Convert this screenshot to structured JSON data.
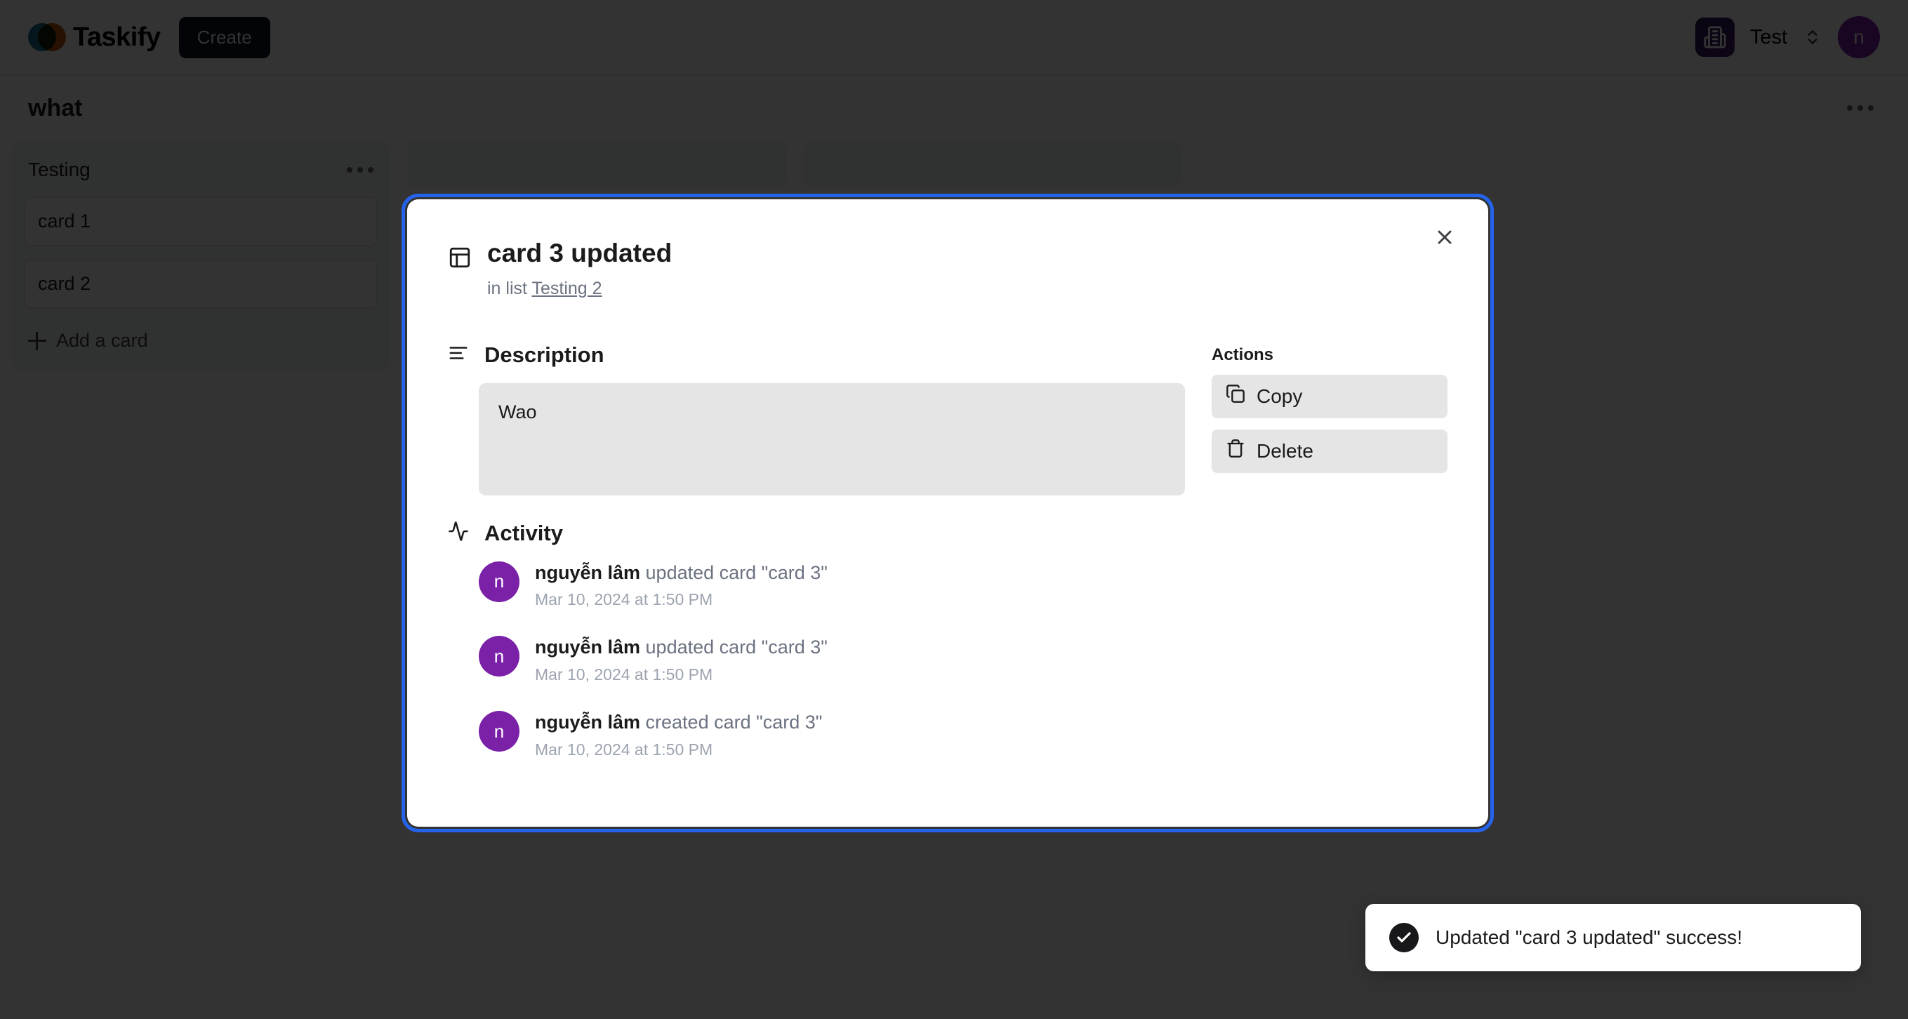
{
  "navbar": {
    "brand": "Taskify",
    "create_label": "Create",
    "org_name": "Test",
    "avatar_initial": "n"
  },
  "board": {
    "title": "what",
    "lists": [
      {
        "title": "Testing",
        "cards": [
          "card 1",
          "card 2"
        ],
        "add_card_label": "Add a card"
      }
    ]
  },
  "modal": {
    "card_title": "card 3 updated",
    "in_list_prefix": "in list",
    "in_list_name": "Testing 2",
    "description": {
      "heading": "Description",
      "value": "Wao"
    },
    "actions": {
      "heading": "Actions",
      "copy_label": "Copy",
      "delete_label": "Delete"
    },
    "activity": {
      "heading": "Activity",
      "items": [
        {
          "avatar": "n",
          "user": "nguyễn lâm",
          "action": " updated card \"card 3\"",
          "time": "Mar 10, 2024 at 1:50 PM"
        },
        {
          "avatar": "n",
          "user": "nguyễn lâm",
          "action": " updated card \"card 3\"",
          "time": "Mar 10, 2024 at 1:50 PM"
        },
        {
          "avatar": "n",
          "user": "nguyễn lâm",
          "action": " created card \"card 3\"",
          "time": "Mar 10, 2024 at 1:50 PM"
        }
      ]
    }
  },
  "toast": {
    "message": "Updated \"card 3 updated\" success!"
  },
  "colors": {
    "accent_blue": "#2563eb",
    "avatar_purple": "#7b21a8",
    "create_btn": "#0b1727",
    "desc_bg": "#e5e5e5",
    "list_bg": "#f1f2f4"
  }
}
